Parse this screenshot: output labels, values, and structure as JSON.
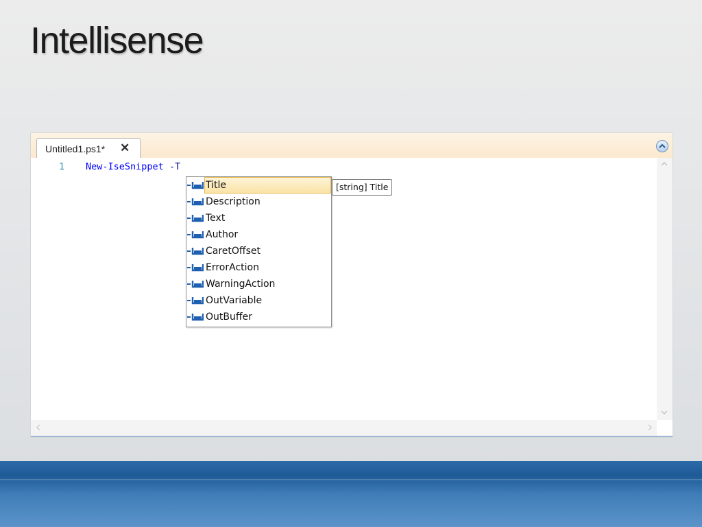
{
  "slide": {
    "title": "Intellisense"
  },
  "editor": {
    "tab": {
      "label": "Untitled1.ps1*",
      "close_glyph": "✕"
    },
    "lines": [
      {
        "number": "1",
        "command": "New-IseSnippet",
        "param": "-T"
      }
    ]
  },
  "intellisense": {
    "items": [
      {
        "label": "Title",
        "selected": true
      },
      {
        "label": "Description"
      },
      {
        "label": "Text"
      },
      {
        "label": "Author"
      },
      {
        "label": "CaretOffset"
      },
      {
        "label": "ErrorAction"
      },
      {
        "label": "WarningAction"
      },
      {
        "label": "OutVariable"
      },
      {
        "label": "OutBuffer"
      }
    ],
    "item_icon": "parameter-icon",
    "tooltip": "[string] Title"
  },
  "colors": {
    "command": "#0000ff",
    "parameter": "#000080",
    "line_number": "#2b91af",
    "selection": "#fbe3a6",
    "band": "#1e5a96"
  }
}
